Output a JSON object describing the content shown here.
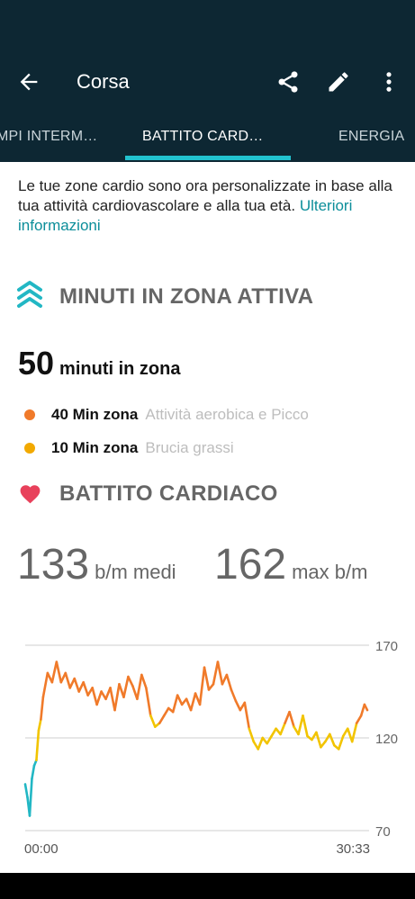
{
  "colors": {
    "appbar_bg": "#0d2733",
    "tab_indicator": "#22c2cf",
    "link": "#0c8e9a",
    "zone_orange": "#f07a2a",
    "zone_yellow": "#f2a900",
    "heart": "#e8415b"
  },
  "appbar": {
    "title": "Corsa",
    "icons": [
      "back-arrow-icon",
      "share-icon",
      "edit-pencil-icon",
      "more-vert-icon"
    ]
  },
  "tabs": [
    {
      "label": "MPI INTERM…"
    },
    {
      "label": "BATTITO CARD…",
      "active": true
    },
    {
      "label": "ENERGIA"
    }
  ],
  "intro": {
    "text": "Le tue zone cardio sono ora personalizzate in base alla tua attività cardiovascolare e alla tua età.",
    "link": "Ulteriori informazioni"
  },
  "active_zone": {
    "title": "MINUTI IN ZONA ATTIVA",
    "minutes": "50",
    "minutes_unit": "minuti in zona",
    "zones": [
      {
        "label": "40 Min zona",
        "desc": "Attività aerobica e Picco"
      },
      {
        "label": "10 Min zona",
        "desc": "Brucia grassi"
      }
    ]
  },
  "heart_rate": {
    "title": "BATTITO CARDIACO",
    "avg_value": "133",
    "avg_unit": "b/m medi",
    "max_value": "162",
    "max_unit": "max b/m"
  },
  "chart_data": {
    "type": "line",
    "x_start_label": "00:00",
    "x_end_label": "30:33",
    "y_ticks": [
      "170",
      "120",
      "70"
    ],
    "ylim": [
      70,
      170
    ],
    "xlim": [
      0,
      30.55
    ],
    "x": [
      0,
      0.2,
      0.4,
      0.6,
      0.8,
      1.0,
      1.2,
      1.4,
      1.6,
      2.0,
      2.4,
      2.8,
      3.2,
      3.6,
      4.0,
      4.4,
      4.8,
      5.2,
      5.6,
      6.0,
      6.4,
      6.8,
      7.2,
      7.6,
      8.0,
      8.4,
      8.8,
      9.2,
      9.6,
      10.0,
      10.4,
      10.8,
      11.2,
      11.6,
      12.0,
      12.4,
      12.8,
      13.2,
      13.6,
      14.0,
      14.4,
      14.8,
      15.2,
      15.6,
      16.0,
      16.4,
      16.8,
      17.2,
      17.6,
      18.0,
      18.4,
      18.8,
      19.2,
      19.6,
      20.0,
      20.4,
      20.8,
      21.2,
      21.6,
      22.0,
      22.4,
      22.8,
      23.2,
      23.6,
      24.0,
      24.4,
      24.8,
      25.2,
      25.6,
      26.0,
      26.4,
      26.8,
      27.2,
      27.6,
      28.0,
      28.4,
      28.8,
      29.2,
      29.6,
      30.0,
      30.3,
      30.55
    ],
    "y": [
      95,
      88,
      78,
      98,
      105,
      108,
      124,
      130,
      142,
      155,
      150,
      161,
      150,
      155,
      147,
      152,
      145,
      150,
      143,
      147,
      138,
      145,
      141,
      147,
      135,
      149,
      142,
      153,
      148,
      141,
      154,
      147,
      132,
      126,
      128,
      132,
      136,
      134,
      143,
      138,
      141,
      135,
      144,
      138,
      158,
      146,
      149,
      161,
      149,
      154,
      146,
      140,
      135,
      139,
      125,
      118,
      114,
      120,
      117,
      121,
      125,
      122,
      128,
      134,
      126,
      122,
      132,
      121,
      119,
      123,
      115,
      118,
      122,
      116,
      114,
      121,
      125,
      118,
      128,
      132,
      138,
      135
    ]
  }
}
